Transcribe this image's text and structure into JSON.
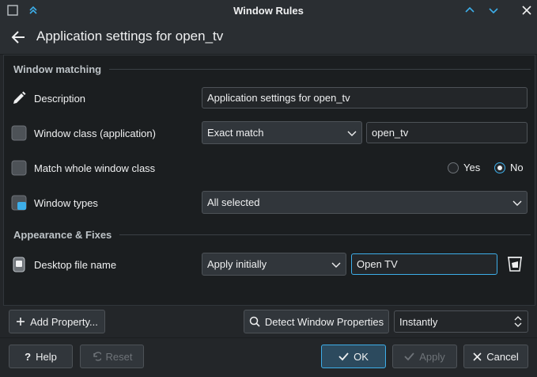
{
  "window": {
    "title": "Window Rules",
    "icons": [
      "keep-above-icon",
      "chevron-up-icon",
      "chevron-down-icon",
      "close-icon"
    ]
  },
  "header": {
    "title": "Application settings for open_tv"
  },
  "sections": {
    "window_matching": "Window matching",
    "appearance_fixes": "Appearance & Fixes"
  },
  "rows": {
    "description": {
      "label": "Description",
      "value": "Application settings for open_tv"
    },
    "window_class": {
      "label": "Window class (application)",
      "match": "Exact match",
      "value": "open_tv"
    },
    "whole_class": {
      "label": "Match whole window class",
      "yes": "Yes",
      "no": "No",
      "selected": "No"
    },
    "window_types": {
      "label": "Window types",
      "value": "All selected"
    },
    "desktop_file": {
      "label": "Desktop file name",
      "policy": "Apply initially",
      "value": "Open TV"
    }
  },
  "toolbar": {
    "add_property": "Add Property...",
    "detect": "Detect Window Properties",
    "detect_delay": "Instantly"
  },
  "footer": {
    "help": "Help",
    "reset": "Reset",
    "ok": "OK",
    "apply": "Apply",
    "cancel": "Cancel"
  },
  "colors": {
    "accent": "#3daee9",
    "background": "#232629"
  }
}
